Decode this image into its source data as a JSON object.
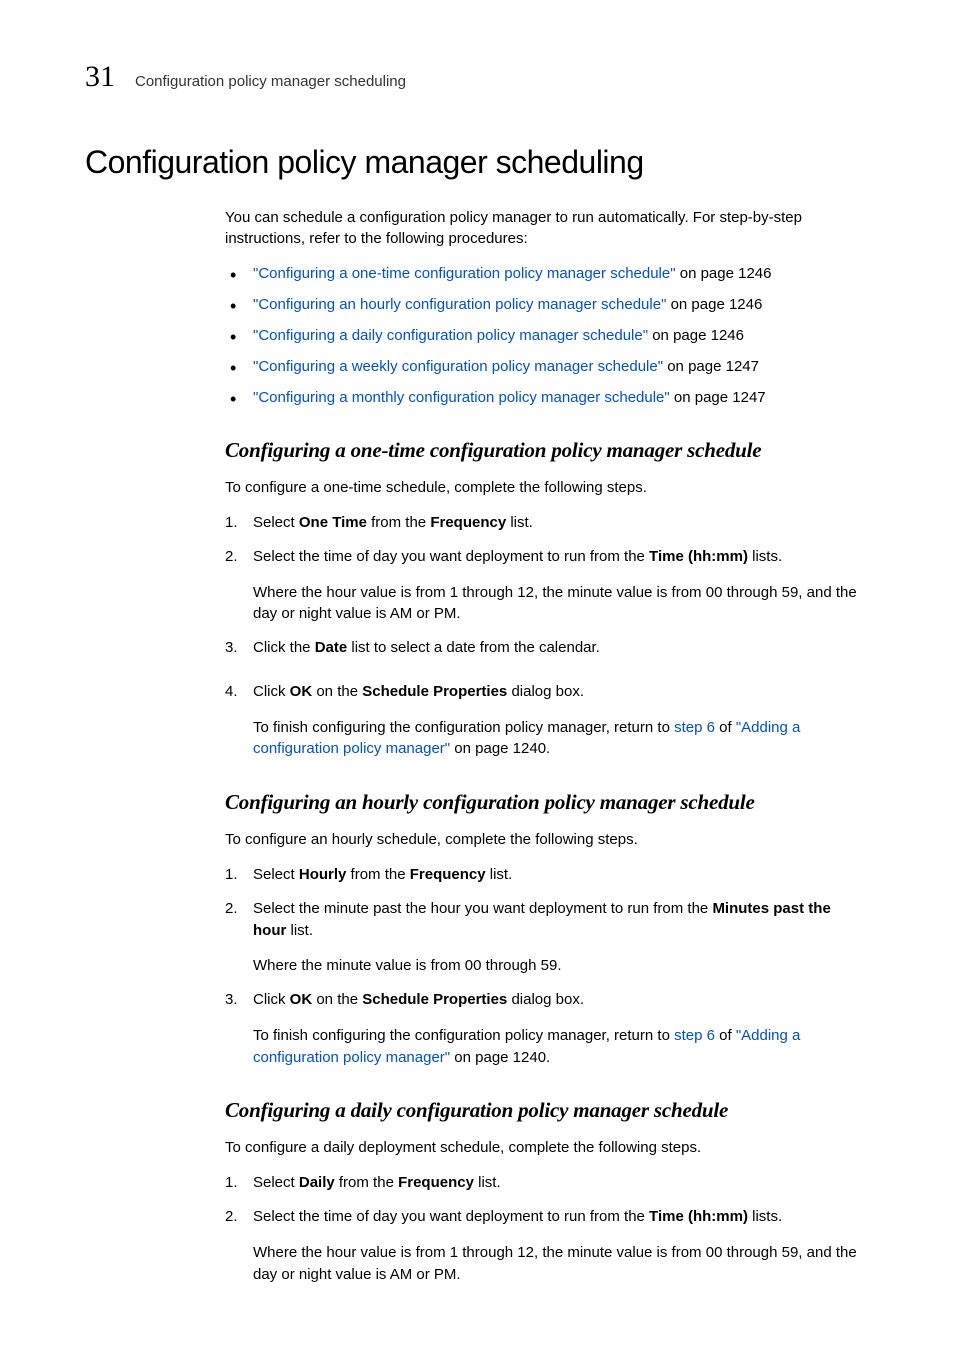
{
  "header": {
    "chapter_number": "31",
    "running_title": "Configuration policy manager scheduling"
  },
  "main_title": "Configuration policy manager scheduling",
  "intro": "You can schedule a configuration policy manager to run automatically. For step-by-step instructions, refer to the following procedures:",
  "toc": [
    {
      "link": "\"Configuring a one-time configuration policy manager schedule\"",
      "suffix": " on page 1246"
    },
    {
      "link": "\"Configuring an hourly configuration policy manager schedule\"",
      "suffix": " on page 1246"
    },
    {
      "link": "\"Configuring a daily configuration policy manager schedule\"",
      "suffix": " on page 1246"
    },
    {
      "link": "\"Configuring a weekly configuration policy manager schedule\"",
      "suffix": " on page 1247"
    },
    {
      "link": "\"Configuring a monthly configuration policy manager schedule\"",
      "suffix": " on page 1247"
    }
  ],
  "s1": {
    "title": "Configuring a one-time configuration policy manager schedule",
    "intro": "To configure a one-time schedule, complete the following steps.",
    "step1_a": "Select ",
    "step1_b": "One Time",
    "step1_c": " from the ",
    "step1_d": "Frequency",
    "step1_e": " list.",
    "step2_a": "Select the time of day you want deployment to run from the ",
    "step2_b": "Time (hh:mm)",
    "step2_c": " lists.",
    "step2_body": "Where the hour value is from 1 through 12, the minute value is from 00 through 59, and the day or night value is AM or PM.",
    "step3_a": "Click the ",
    "step3_b": "Date",
    "step3_c": " list to select a date from the calendar.",
    "step4_a": "Click ",
    "step4_b": "OK",
    "step4_c": " on the ",
    "step4_d": "Schedule Properties",
    "step4_e": " dialog box.",
    "step4_body_a": "To finish configuring the configuration policy manager, return to ",
    "step4_link1": "step 6",
    "step4_body_b": " of ",
    "step4_link2": "\"Adding a configuration policy manager\"",
    "step4_body_c": " on page 1240."
  },
  "s2": {
    "title": "Configuring an hourly configuration policy manager schedule",
    "intro": "To configure an hourly schedule, complete the following steps.",
    "step1_a": "Select ",
    "step1_b": "Hourly",
    "step1_c": " from the ",
    "step1_d": "Frequency",
    "step1_e": " list.",
    "step2_a": "Select the minute past the hour you want deployment to run from the ",
    "step2_b": "Minutes past the hour",
    "step2_c": " list.",
    "step2_body": "Where the minute value is from 00 through 59.",
    "step3_a": "Click ",
    "step3_b": "OK",
    "step3_c": " on the ",
    "step3_d": "Schedule Properties",
    "step3_e": " dialog box.",
    "step3_body_a": "To finish configuring the configuration policy manager, return to ",
    "step3_link1": "step 6",
    "step3_body_b": " of ",
    "step3_link2": "\"Adding a configuration policy manager\"",
    "step3_body_c": " on page 1240."
  },
  "s3": {
    "title": "Configuring a daily configuration policy manager schedule",
    "intro": "To configure a daily deployment schedule, complete the following steps.",
    "step1_a": "Select ",
    "step1_b": "Daily",
    "step1_c": " from the ",
    "step1_d": "Frequency",
    "step1_e": " list.",
    "step2_a": "Select the time of day you want deployment to run from the ",
    "step2_b": "Time (hh:mm)",
    "step2_c": " lists.",
    "step2_body": "Where the hour value is from 1 through 12, the minute value is from 00 through 59, and the day or night value is AM or PM."
  }
}
